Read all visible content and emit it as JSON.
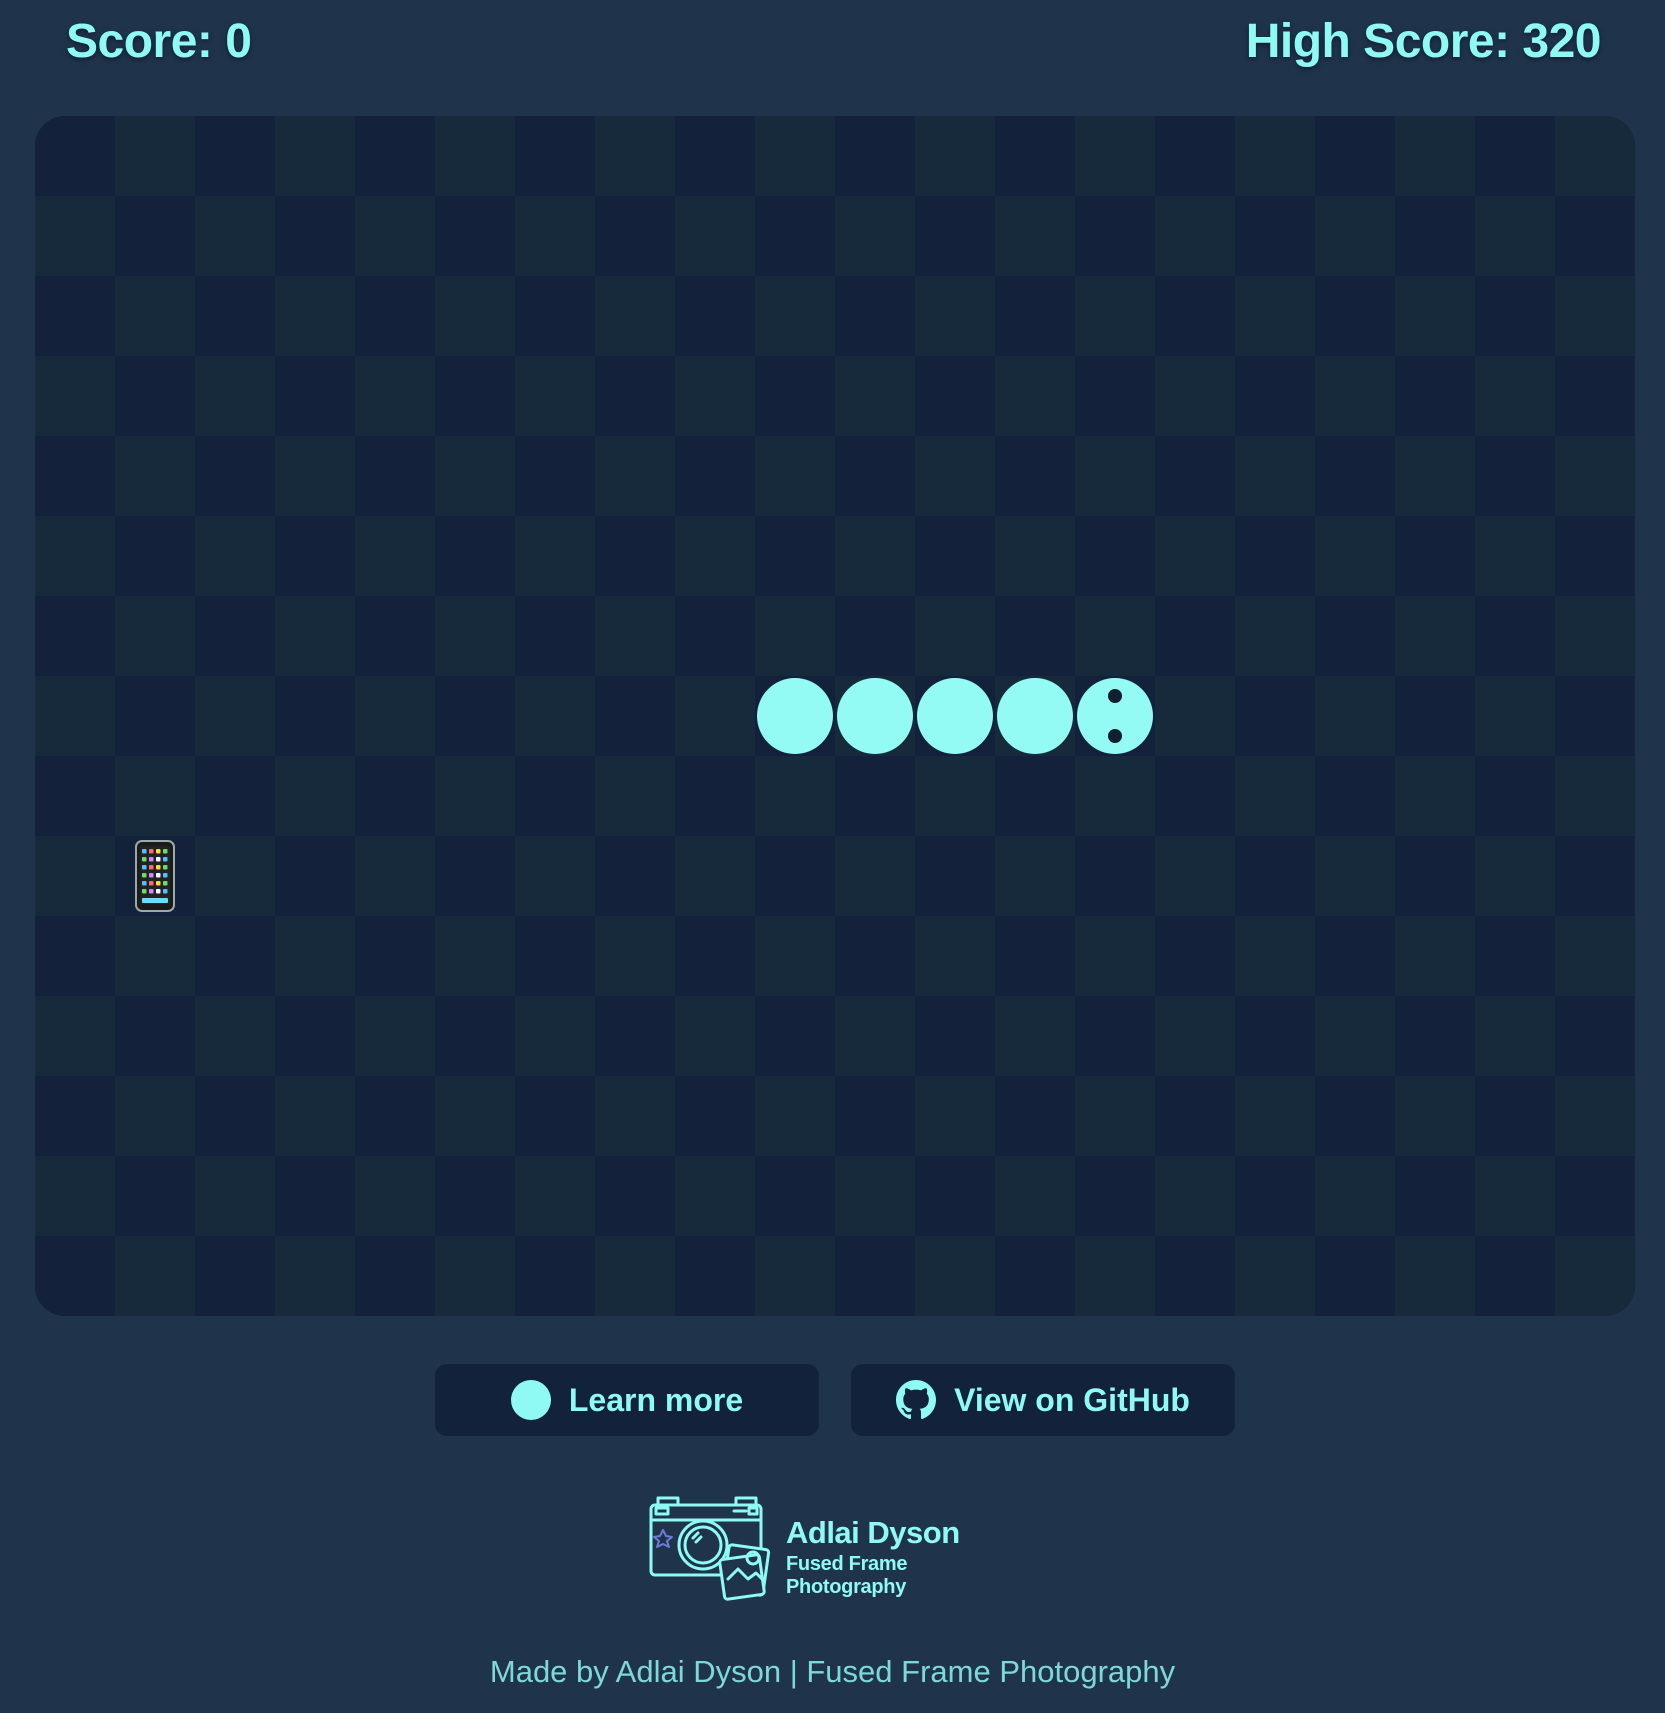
{
  "header": {
    "score_label": "Score: 0",
    "high_score_label": "High Score: 320"
  },
  "game": {
    "grid_cols": 20,
    "grid_rows": 15,
    "snake": [
      [
        9,
        7
      ],
      [
        10,
        7
      ],
      [
        11,
        7
      ],
      [
        12,
        7
      ],
      [
        13,
        7
      ]
    ],
    "head_direction": "right",
    "food": {
      "cell": [
        1,
        9
      ],
      "icon": "mobile-phone-icon"
    },
    "colors": {
      "snake": "#93fbf4",
      "board_dark": "#13213a",
      "board_light": "#172a3b",
      "accent": "#8ffaf4",
      "page_bg": "#1f344b"
    }
  },
  "buttons": {
    "learn_more": {
      "label": "Learn more",
      "icon": "circle-icon"
    },
    "github": {
      "label": "View on GitHub",
      "icon": "github-icon"
    }
  },
  "logo": {
    "name": "Adlai Dyson",
    "subtitle": "Fused Frame Photography",
    "icon": "camera-photo-icon"
  },
  "footer": {
    "text": "Made by Adlai Dyson | Fused Frame Photography"
  }
}
